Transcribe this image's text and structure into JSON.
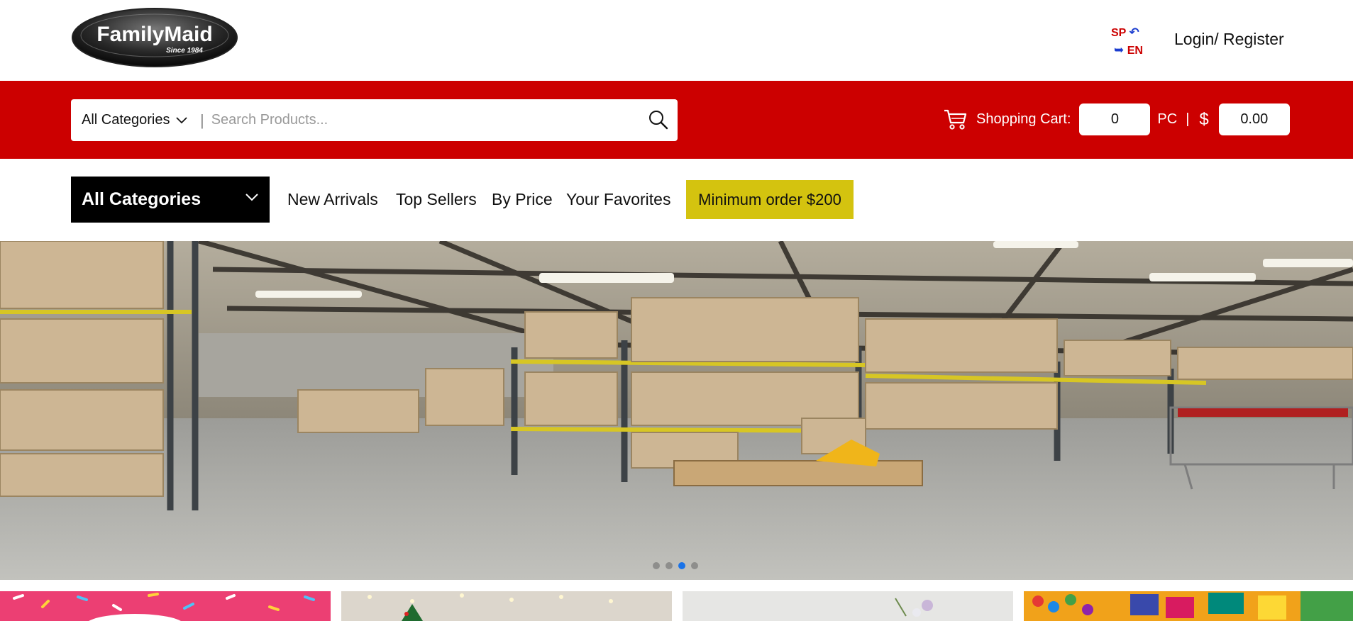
{
  "header": {
    "logo_text": "FamilyMaid",
    "logo_sub": "Since 1984",
    "lang_sp": "SP",
    "lang_en": "EN",
    "login_label": "Login/ Register"
  },
  "search": {
    "category_label": "All Categories",
    "separator": "|",
    "placeholder": "Search Products..."
  },
  "cart": {
    "label": "Shopping Cart:",
    "count": "0",
    "unit": "PC",
    "separator": "|",
    "currency": "$",
    "total": "0.00"
  },
  "nav": {
    "all_categories": "All Categories",
    "links": [
      "New Arrivals",
      "Top Sellers",
      "By Price",
      "Your Favorites"
    ],
    "min_order": "Minimum order $200"
  },
  "hero": {
    "slide_count": 4,
    "active_slide": 3
  },
  "colors": {
    "brand_red": "#cc0000",
    "promo_yellow": "#d4c30f",
    "dark": "#000000"
  }
}
